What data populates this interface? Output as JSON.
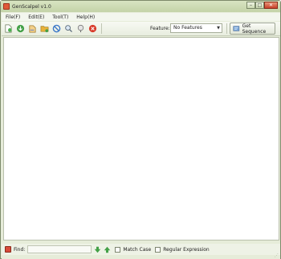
{
  "window": {
    "title": "GenScalpel v1.0"
  },
  "menu": [
    {
      "label": "File(F)"
    },
    {
      "label": "Edit(E)"
    },
    {
      "label": "Tool(T)"
    },
    {
      "label": "Help(H)"
    }
  ],
  "toolbar": {
    "buttons": [
      {
        "icon": "new-file-icon",
        "color": "#4caf50"
      },
      {
        "icon": "download-icon",
        "color": "#43a047"
      },
      {
        "icon": "open-file-icon",
        "color": "#e8a93c"
      },
      {
        "icon": "folder-icon",
        "color": "#e8b23a"
      },
      {
        "icon": "block-icon",
        "color": "#3c78c8"
      },
      {
        "icon": "search-icon",
        "color": "#6a8fb5"
      },
      {
        "icon": "help-icon",
        "color": "#7a7a7a"
      },
      {
        "icon": "stop-icon",
        "color": "#d83a2a"
      }
    ],
    "feature_label": "Feature:",
    "feature_value": "No Features",
    "get_sequence_label": "Get Sequence"
  },
  "findbar": {
    "label": "Find:",
    "value": "",
    "match_case": "Match Case",
    "match_case_checked": false,
    "regex": "Regular Expression",
    "regex_checked": false
  }
}
